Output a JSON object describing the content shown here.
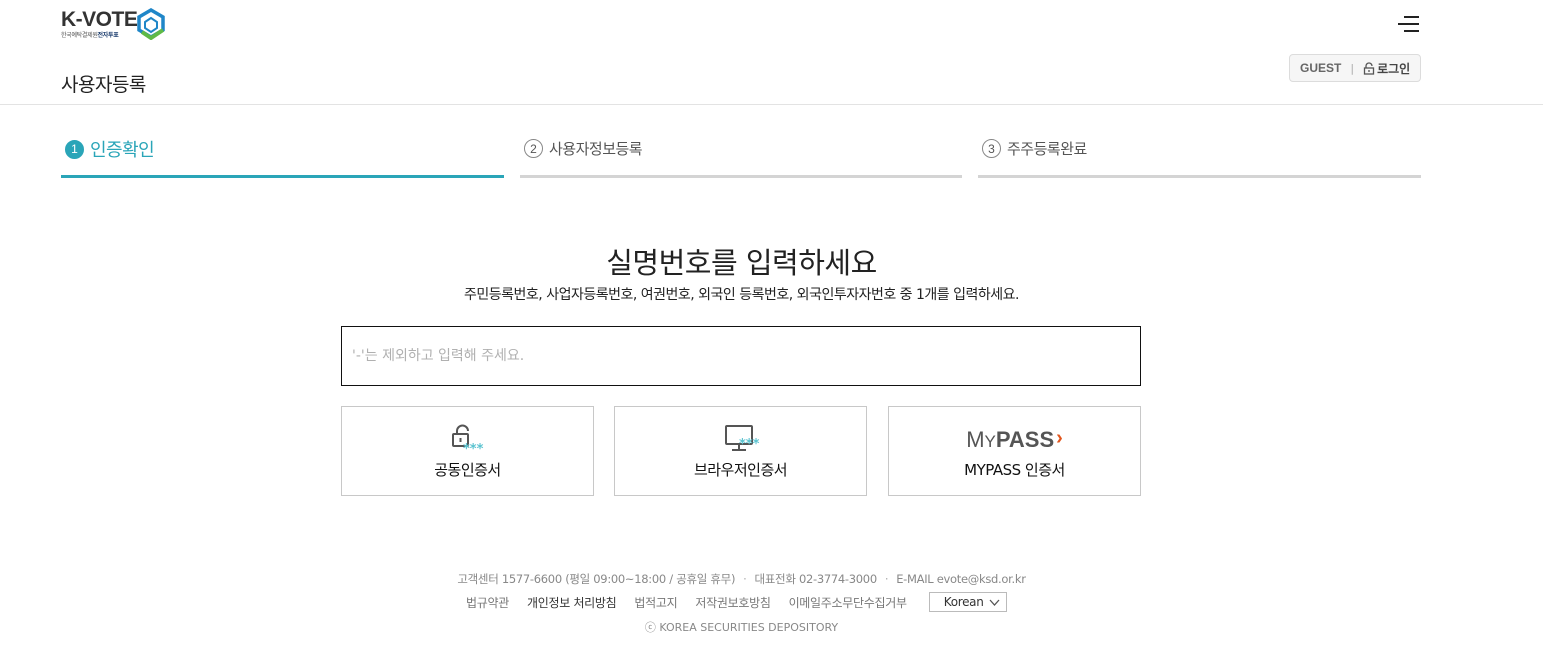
{
  "header": {
    "logo_text": "K-VOTE",
    "logo_sub_prefix": "한국예탁결제원",
    "logo_sub_bold": "전자투표",
    "page_title": "사용자등록",
    "user_label": "GUEST",
    "user_sep": "|",
    "login_label": "로그인"
  },
  "steps": [
    {
      "num": "1",
      "label": "인증확인",
      "active": true
    },
    {
      "num": "2",
      "label": "사용자정보등록",
      "active": false
    },
    {
      "num": "3",
      "label": "주주등록완료",
      "active": false
    }
  ],
  "main": {
    "title": "실명번호를 입력하세요",
    "subtitle": "주민등록번호, 사업자등록번호, 여권번호, 외국인 등록번호, 외국인투자자번호 중 1개를 입력하세요.",
    "input_value": "",
    "input_placeholder": "'-'는 제외하고 입력해 주세요."
  },
  "cert_buttons": [
    {
      "label": "공동인증서",
      "icon": "lock-icon"
    },
    {
      "label": "브라우저인증서",
      "icon": "monitor-icon"
    },
    {
      "label": "MYPASS 인증서",
      "icon": "mypass-logo",
      "logo_text_a": "M",
      "logo_text_b": "Y",
      "logo_text_c": "PASS",
      "logo_chevron": "›"
    }
  ],
  "footer": {
    "contact": "고객센터 1577-6600 (평일 09:00~18:00 / 공휴일 휴무)",
    "tel": "대표전화 02-3774-3000",
    "email": "E-MAIL evote@ksd.or.kr",
    "links": [
      "법규약관",
      "개인정보 처리방침",
      "법적고지",
      "저작권보호방침",
      "이메일주소무단수집거부"
    ],
    "language": "Korean",
    "copyright": "ⓒ KOREA SECURITIES DEPOSITORY"
  },
  "colors": {
    "accent": "#2aa5b8",
    "inactive_step": "#d4d4d4",
    "mypass_chevron": "#e2551c",
    "logo_mark_blue": "#1f86c8",
    "logo_mark_green": "#5fb946"
  }
}
